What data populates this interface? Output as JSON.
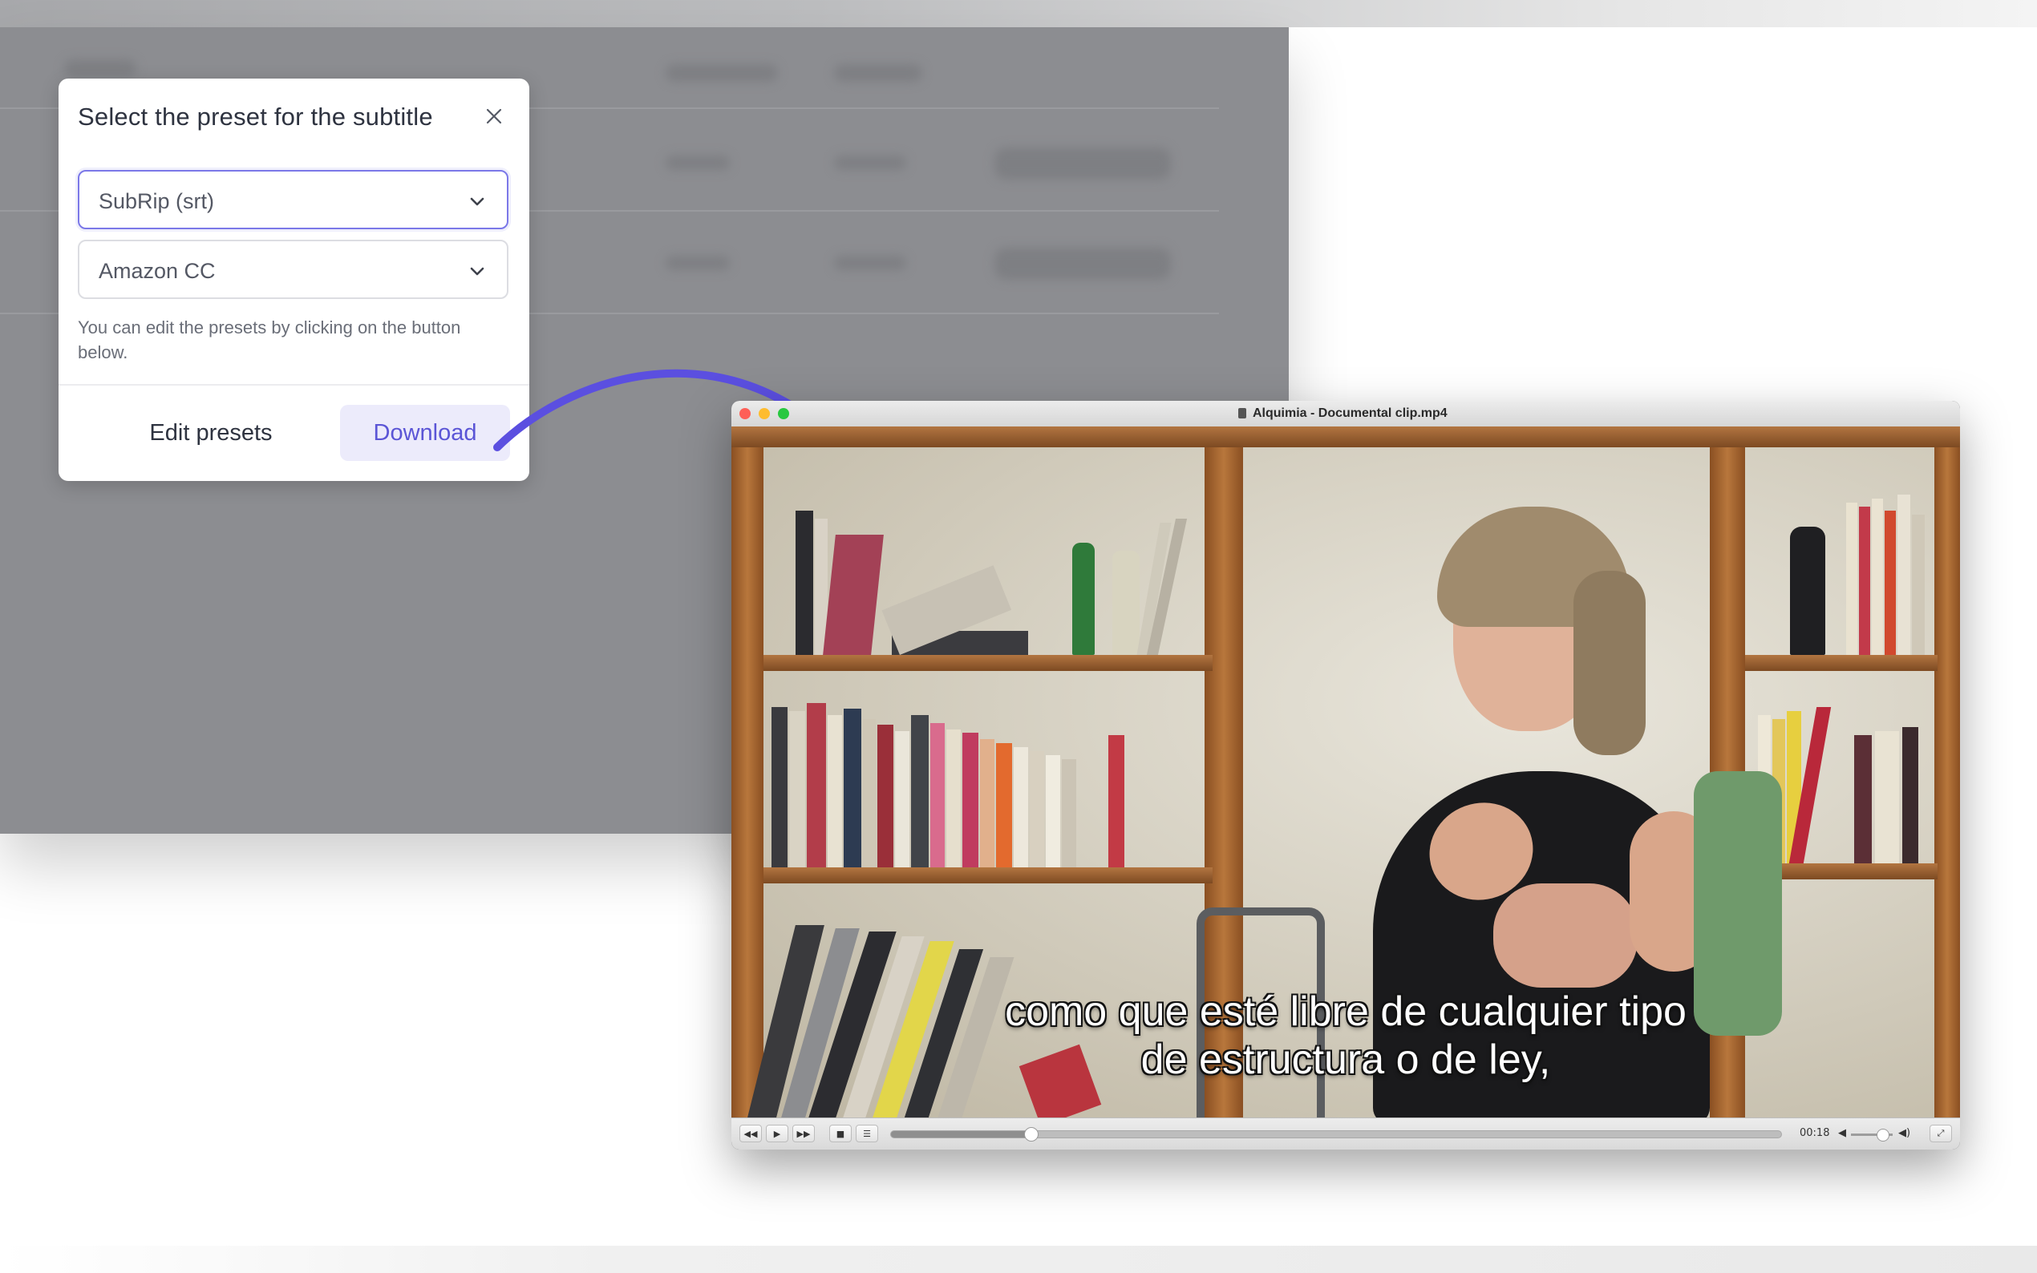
{
  "modal": {
    "title": "Select the preset for the subtitle",
    "format_select": {
      "value": "SubRip (srt)"
    },
    "preset_select": {
      "value": "Amazon CC"
    },
    "hint": "You can edit the presets by clicking on the button below.",
    "edit_button": "Edit presets",
    "download_button": "Download"
  },
  "player": {
    "window_title": "Alquimia - Documental clip.mp4",
    "subtitle_lines": [
      "como que esté libre de cualquier tipo",
      "de estructura o de ley,"
    ],
    "time": "00:18",
    "progress_fraction": 0.157,
    "volume_fraction": 0.75,
    "buttons": {
      "rewind": "◀◀",
      "play": "▶",
      "forward": "▶▶",
      "stop": "■",
      "subtitles": "☰",
      "vol_low": "◀",
      "vol_high": "◀)",
      "fullscreen": "⤢"
    }
  },
  "colors": {
    "accent": "#5b55d6",
    "accent_bg": "#ecebfb",
    "arrow": "#5b4fe0",
    "select_active_border": "#7b78e8"
  }
}
